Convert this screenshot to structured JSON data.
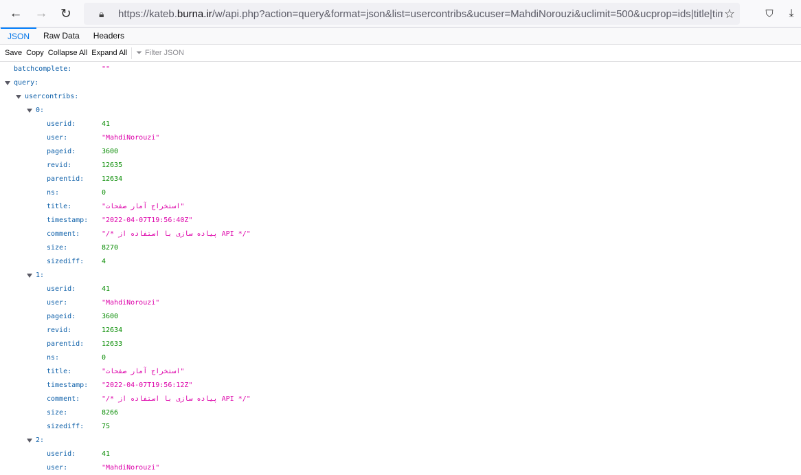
{
  "browser": {
    "url_prefix": "https://kateb.",
    "url_domain": "burna.ir",
    "url_rest": "/w/api.php?action=query&format=json&list=usercontribs&ucuser=MahdiNorouzi&uclimit=500&ucprop=ids|title|timestamp"
  },
  "tabs": [
    "JSON",
    "Raw Data",
    "Headers"
  ],
  "toolbar": {
    "save": "Save",
    "copy": "Copy",
    "collapse": "Collapse All",
    "expand": "Expand All",
    "filter_placeholder": "Filter JSON"
  },
  "json": {
    "batchcomplete": "\"\"",
    "query_key": "query:",
    "usercontribs_key": "usercontribs:",
    "contribs": [
      {
        "index": "0:",
        "fields": [
          [
            "userid:",
            "41",
            "num"
          ],
          [
            "user:",
            "\"MahdiNorouzi\"",
            "str"
          ],
          [
            "pageid:",
            "3600",
            "num"
          ],
          [
            "revid:",
            "12635",
            "num"
          ],
          [
            "parentid:",
            "12634",
            "num"
          ],
          [
            "ns:",
            "0",
            "num"
          ],
          [
            "title:",
            "\"استخراج آمار صفحات\"",
            "str"
          ],
          [
            "timestamp:",
            "\"2022-04-07T19:56:40Z\"",
            "str"
          ],
          [
            "comment:",
            "\"/* پیاده سازی با استفاده از API */\"",
            "str"
          ],
          [
            "size:",
            "8270",
            "num"
          ],
          [
            "sizediff:",
            "4",
            "num"
          ]
        ]
      },
      {
        "index": "1:",
        "fields": [
          [
            "userid:",
            "41",
            "num"
          ],
          [
            "user:",
            "\"MahdiNorouzi\"",
            "str"
          ],
          [
            "pageid:",
            "3600",
            "num"
          ],
          [
            "revid:",
            "12634",
            "num"
          ],
          [
            "parentid:",
            "12633",
            "num"
          ],
          [
            "ns:",
            "0",
            "num"
          ],
          [
            "title:",
            "\"استخراج آمار صفحات\"",
            "str"
          ],
          [
            "timestamp:",
            "\"2022-04-07T19:56:12Z\"",
            "str"
          ],
          [
            "comment:",
            "\"/* پیاده سازی با استفاده از API */\"",
            "str"
          ],
          [
            "size:",
            "8266",
            "num"
          ],
          [
            "sizediff:",
            "75",
            "num"
          ]
        ]
      },
      {
        "index": "2:",
        "fields": [
          [
            "userid:",
            "41",
            "num"
          ],
          [
            "user:",
            "\"MahdiNorouzi\"",
            "str"
          ]
        ]
      }
    ]
  }
}
